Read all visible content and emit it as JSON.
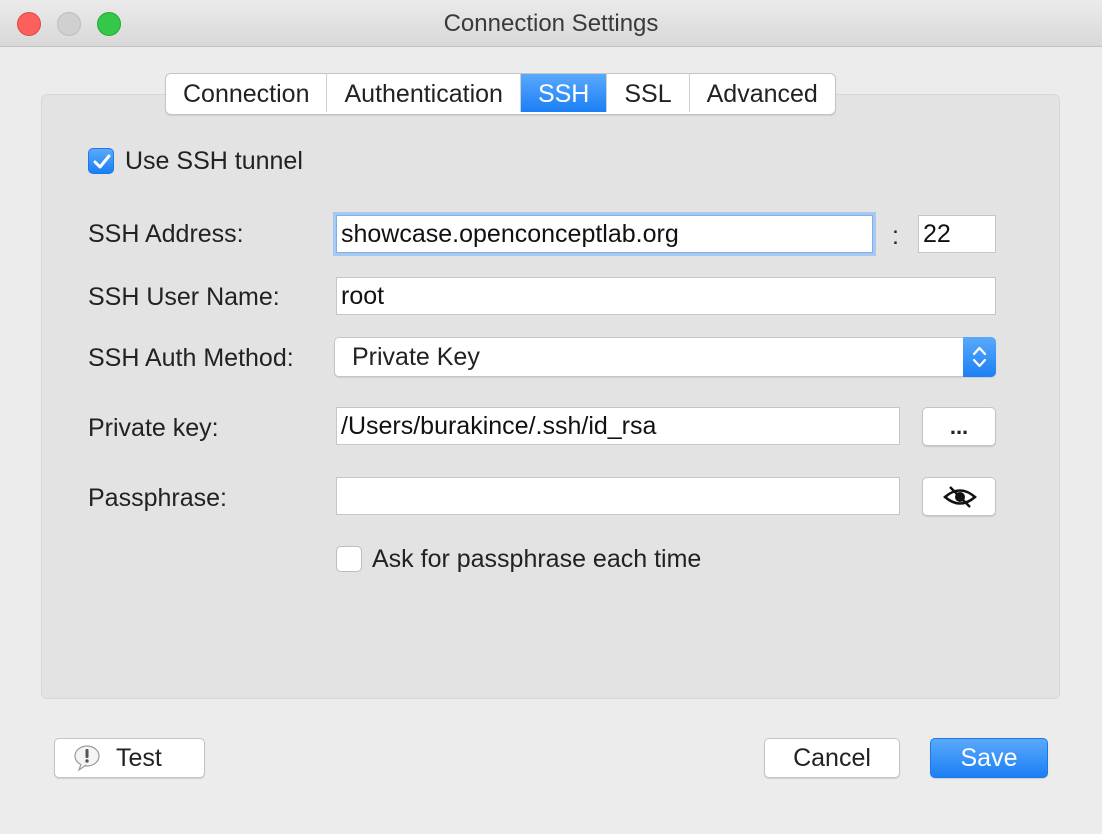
{
  "window": {
    "title": "Connection Settings"
  },
  "tabs": [
    {
      "label": "Connection"
    },
    {
      "label": "Authentication"
    },
    {
      "label": "SSH",
      "active": true
    },
    {
      "label": "SSL"
    },
    {
      "label": "Advanced"
    }
  ],
  "ssh": {
    "use_tunnel_label": "Use SSH tunnel",
    "use_tunnel_checked": true,
    "address_label": "SSH Address:",
    "address_value": "showcase.openconceptlab.org",
    "port_separator": ":",
    "port_value": "22",
    "username_label": "SSH User Name:",
    "username_value": "root",
    "auth_method_label": "SSH Auth Method:",
    "auth_method_value": "Private Key",
    "private_key_label": "Private key:",
    "private_key_value": "/Users/burakince/.ssh/id_rsa",
    "browse_label": "...",
    "passphrase_label": "Passphrase:",
    "passphrase_value": "",
    "reveal_icon": "eye-slash-icon",
    "ask_passphrase_label": "Ask for passphrase each time",
    "ask_passphrase_checked": false
  },
  "footer": {
    "test_label": "Test",
    "test_icon": "exclamation-bubble-icon",
    "cancel_label": "Cancel",
    "save_label": "Save"
  },
  "colors": {
    "accent": "#1b7ff5",
    "close": "#fc605c",
    "maximize": "#34c84a"
  }
}
